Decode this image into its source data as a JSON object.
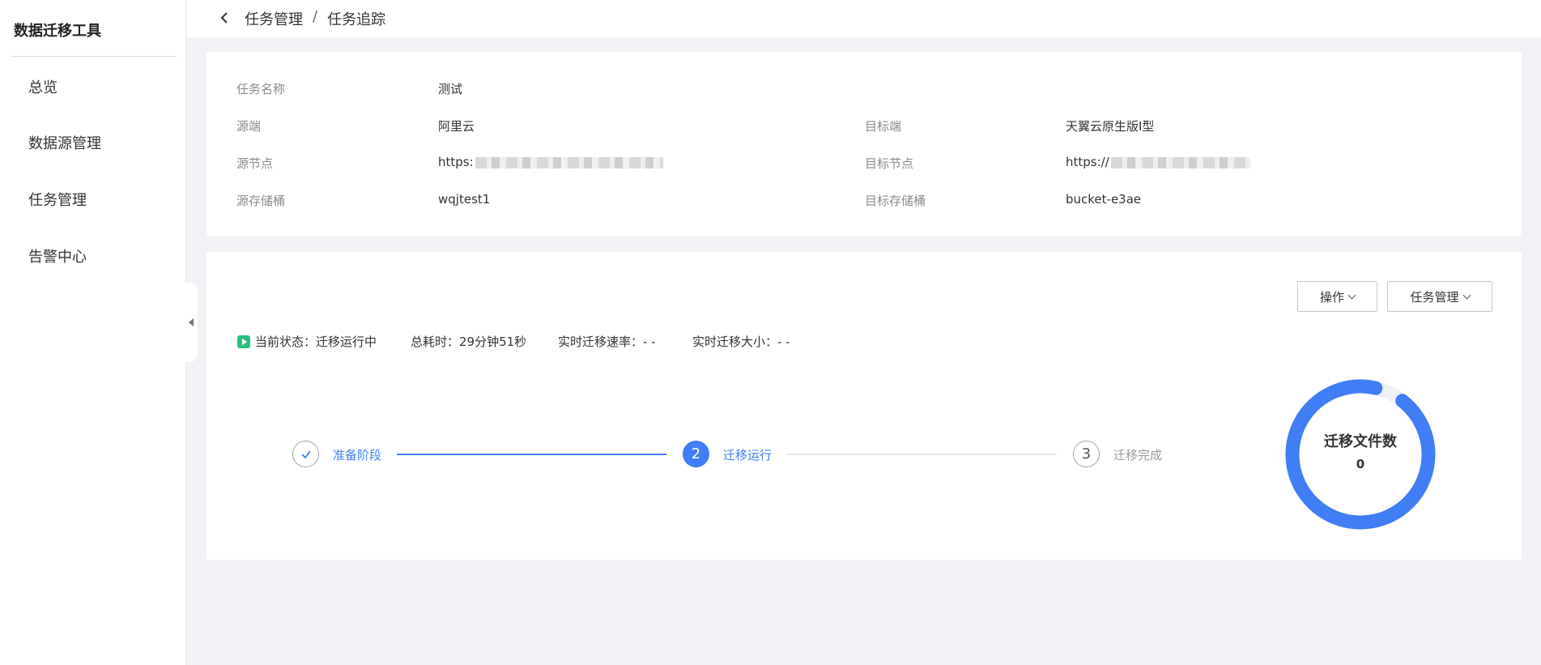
{
  "app": {
    "title": "数据迁移工具"
  },
  "sidebar": {
    "items": [
      {
        "label": "总览"
      },
      {
        "label": "数据源管理"
      },
      {
        "label": "任务管理"
      },
      {
        "label": "告警中心"
      }
    ]
  },
  "breadcrumb": {
    "parent": "任务管理",
    "separator": "/",
    "current": "任务追踪"
  },
  "task_info": {
    "name_label": "任务名称",
    "name_value": "测试",
    "source_label": "源端",
    "source_value": "阿里云",
    "target_label": "目标端",
    "target_value": "天翼云原生版I型",
    "source_node_label": "源节点",
    "source_node_value": "https:",
    "target_node_label": "目标节点",
    "target_node_value": "https://",
    "source_bucket_label": "源存储桶",
    "source_bucket_value": "wqjtest1",
    "target_bucket_label": "目标存储桶",
    "target_bucket_value": "bucket-e3ae"
  },
  "actions": {
    "operate_label": "操作",
    "task_manage_label": "任务管理"
  },
  "status": {
    "current": "当前状态：迁移运行中",
    "elapsed": "总耗时：29分钟51秒",
    "speed": "实时迁移速率：- -",
    "size": "实时迁移大小：- -"
  },
  "steps": [
    {
      "number": "",
      "label": "准备阶段",
      "state": "done"
    },
    {
      "number": "2",
      "label": "迁移运行",
      "state": "active"
    },
    {
      "number": "3",
      "label": "迁移完成",
      "state": "pending"
    }
  ],
  "migration_count": {
    "title": "迁移文件数",
    "value": "0",
    "progress": 0.93
  },
  "colors": {
    "primary": "#3f7ef4",
    "success": "#2bc07f",
    "track": "#eef0f8"
  }
}
